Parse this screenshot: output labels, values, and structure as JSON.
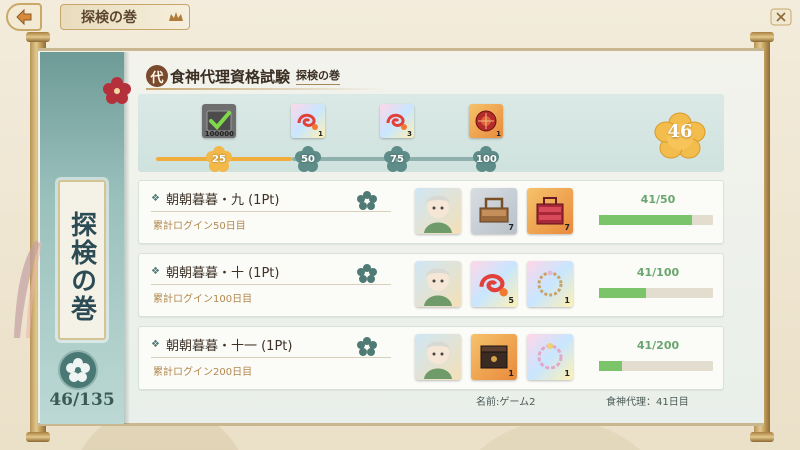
{
  "header": {
    "page_title": "探検の巻"
  },
  "scroll_header": {
    "badge": "代",
    "title": "食神代理資格試験",
    "subtitle": "探検の巻"
  },
  "side_panel": {
    "vertical_title": "探検の巻",
    "count": "46/135"
  },
  "progress": {
    "points": "46",
    "fill_fraction": 0.46,
    "milestones": [
      {
        "label": "25",
        "achieved": true,
        "item": "token-voucher-icon",
        "count": "100000"
      },
      {
        "label": "50",
        "achieved": false,
        "item": "red-swirl-charm-icon",
        "count": "1"
      },
      {
        "label": "75",
        "achieved": false,
        "item": "red-swirl-charm-icon",
        "count": "3"
      },
      {
        "label": "100",
        "achieved": false,
        "item": "red-seal-box-icon",
        "count": "1"
      }
    ]
  },
  "rows": [
    {
      "title": "朝朝暮暮・九 (1Pt)",
      "subtitle": "累計ログイン50日目",
      "progress_text": "41/50",
      "progress": 0.82,
      "rewards": [
        {
          "icon": "character-portrait-icon",
          "count": ""
        },
        {
          "icon": "wooden-lunchbox-icon",
          "count": "7"
        },
        {
          "icon": "red-lunchbox-icon",
          "count": "7"
        }
      ]
    },
    {
      "title": "朝朝暮暮・十 (1Pt)",
      "subtitle": "累計ログイン100日目",
      "progress_text": "41/100",
      "progress": 0.41,
      "rewards": [
        {
          "icon": "character-portrait-icon",
          "count": ""
        },
        {
          "icon": "red-swirl-charm-icon",
          "count": "5"
        },
        {
          "icon": "bead-bracelet-icon",
          "count": "1"
        }
      ]
    },
    {
      "title": "朝朝暮暮・十一 (1Pt)",
      "subtitle": "累計ログイン200日目",
      "progress_text": "41/200",
      "progress": 0.205,
      "rewards": [
        {
          "icon": "character-portrait-icon",
          "count": ""
        },
        {
          "icon": "dark-jewel-box-icon",
          "count": "1"
        },
        {
          "icon": "flower-bracelet-icon",
          "count": "1"
        }
      ]
    }
  ],
  "footer": {
    "name": "名前:ゲーム2",
    "rank": "食神代理：41日目"
  },
  "colors": {
    "teal": "#6e9b97",
    "gold": "#f0ad3c",
    "green": "#7cc46a",
    "red": "#b4303a"
  }
}
